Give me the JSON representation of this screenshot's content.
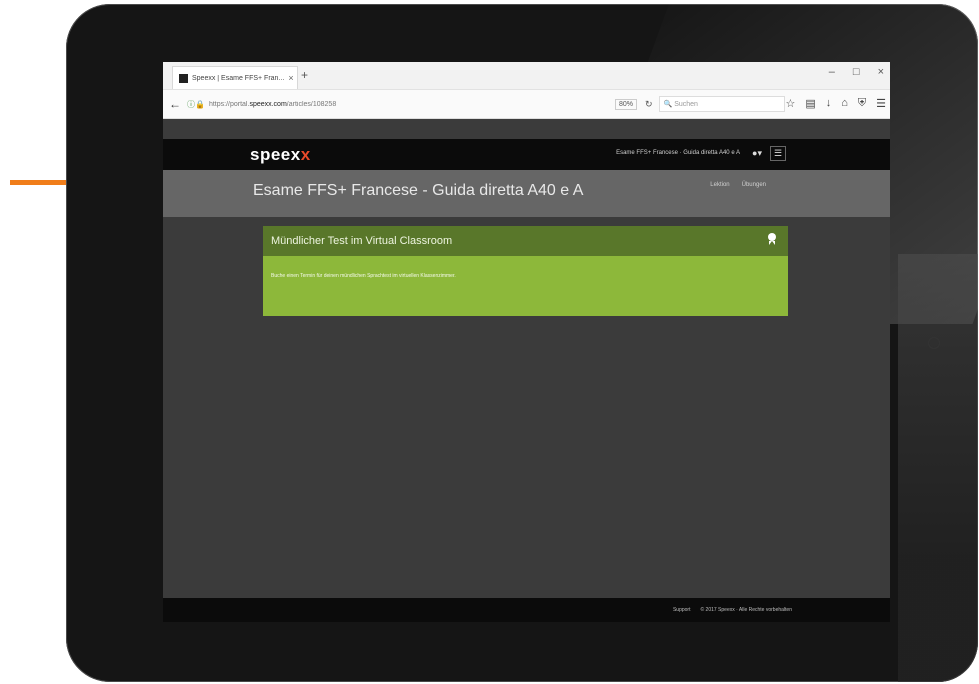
{
  "browser": {
    "tab_title": "Speexx | Esame FFS+ Fran...",
    "tab_close": "×",
    "new_tab": "+",
    "window_controls": [
      "–",
      "□",
      "×"
    ],
    "url_prefix": "https://portal.",
    "url_domain": "speexx.com",
    "url_path": "/articles/108258",
    "zoom": "80%",
    "search_placeholder": "Suchen",
    "toolbar_icons": [
      "star-icon",
      "clipboard-icon",
      "download-icon",
      "home-icon",
      "shield-icon",
      "menu-icon"
    ]
  },
  "site": {
    "logo_main": "speex",
    "logo_x": "x",
    "breadcrumb": "Esame FFS+ Francese · Guida diretta A40 e A",
    "page_title": "Esame FFS+ Francese - Guida diretta A40 e A",
    "meta_left": "Lektion",
    "meta_right": "Übungen"
  },
  "card": {
    "title": "Mündlicher Test im Virtual Classroom",
    "body": "Buche einen Termin für deinen mündlichen Sprachtest im virtuellen Klassenzimmer."
  },
  "footer": {
    "support": "Support",
    "copyright": "© 2017 Speexx · Alle Rechte vorbehalten"
  },
  "colors": {
    "arrow": "#f07d1a",
    "card_head": "#59772a",
    "card_body": "#8db83a",
    "header_bar": "#666666",
    "logo_accent": "#e84a2a"
  }
}
